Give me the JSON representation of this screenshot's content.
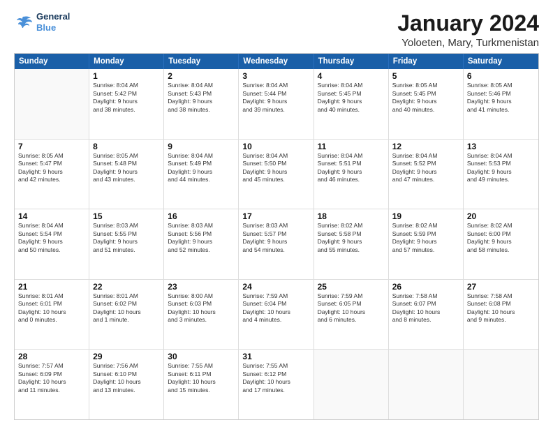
{
  "logo": {
    "line1": "General",
    "line2": "Blue"
  },
  "title": "January 2024",
  "subtitle": "Yoloeten, Mary, Turkmenistan",
  "weekdays": [
    "Sunday",
    "Monday",
    "Tuesday",
    "Wednesday",
    "Thursday",
    "Friday",
    "Saturday"
  ],
  "weeks": [
    [
      {
        "day": "",
        "info": ""
      },
      {
        "day": "1",
        "info": "Sunrise: 8:04 AM\nSunset: 5:42 PM\nDaylight: 9 hours\nand 38 minutes."
      },
      {
        "day": "2",
        "info": "Sunrise: 8:04 AM\nSunset: 5:43 PM\nDaylight: 9 hours\nand 38 minutes."
      },
      {
        "day": "3",
        "info": "Sunrise: 8:04 AM\nSunset: 5:44 PM\nDaylight: 9 hours\nand 39 minutes."
      },
      {
        "day": "4",
        "info": "Sunrise: 8:04 AM\nSunset: 5:45 PM\nDaylight: 9 hours\nand 40 minutes."
      },
      {
        "day": "5",
        "info": "Sunrise: 8:05 AM\nSunset: 5:45 PM\nDaylight: 9 hours\nand 40 minutes."
      },
      {
        "day": "6",
        "info": "Sunrise: 8:05 AM\nSunset: 5:46 PM\nDaylight: 9 hours\nand 41 minutes."
      }
    ],
    [
      {
        "day": "7",
        "info": "Sunrise: 8:05 AM\nSunset: 5:47 PM\nDaylight: 9 hours\nand 42 minutes."
      },
      {
        "day": "8",
        "info": "Sunrise: 8:05 AM\nSunset: 5:48 PM\nDaylight: 9 hours\nand 43 minutes."
      },
      {
        "day": "9",
        "info": "Sunrise: 8:04 AM\nSunset: 5:49 PM\nDaylight: 9 hours\nand 44 minutes."
      },
      {
        "day": "10",
        "info": "Sunrise: 8:04 AM\nSunset: 5:50 PM\nDaylight: 9 hours\nand 45 minutes."
      },
      {
        "day": "11",
        "info": "Sunrise: 8:04 AM\nSunset: 5:51 PM\nDaylight: 9 hours\nand 46 minutes."
      },
      {
        "day": "12",
        "info": "Sunrise: 8:04 AM\nSunset: 5:52 PM\nDaylight: 9 hours\nand 47 minutes."
      },
      {
        "day": "13",
        "info": "Sunrise: 8:04 AM\nSunset: 5:53 PM\nDaylight: 9 hours\nand 49 minutes."
      }
    ],
    [
      {
        "day": "14",
        "info": "Sunrise: 8:04 AM\nSunset: 5:54 PM\nDaylight: 9 hours\nand 50 minutes."
      },
      {
        "day": "15",
        "info": "Sunrise: 8:03 AM\nSunset: 5:55 PM\nDaylight: 9 hours\nand 51 minutes."
      },
      {
        "day": "16",
        "info": "Sunrise: 8:03 AM\nSunset: 5:56 PM\nDaylight: 9 hours\nand 52 minutes."
      },
      {
        "day": "17",
        "info": "Sunrise: 8:03 AM\nSunset: 5:57 PM\nDaylight: 9 hours\nand 54 minutes."
      },
      {
        "day": "18",
        "info": "Sunrise: 8:02 AM\nSunset: 5:58 PM\nDaylight: 9 hours\nand 55 minutes."
      },
      {
        "day": "19",
        "info": "Sunrise: 8:02 AM\nSunset: 5:59 PM\nDaylight: 9 hours\nand 57 minutes."
      },
      {
        "day": "20",
        "info": "Sunrise: 8:02 AM\nSunset: 6:00 PM\nDaylight: 9 hours\nand 58 minutes."
      }
    ],
    [
      {
        "day": "21",
        "info": "Sunrise: 8:01 AM\nSunset: 6:01 PM\nDaylight: 10 hours\nand 0 minutes."
      },
      {
        "day": "22",
        "info": "Sunrise: 8:01 AM\nSunset: 6:02 PM\nDaylight: 10 hours\nand 1 minute."
      },
      {
        "day": "23",
        "info": "Sunrise: 8:00 AM\nSunset: 6:03 PM\nDaylight: 10 hours\nand 3 minutes."
      },
      {
        "day": "24",
        "info": "Sunrise: 7:59 AM\nSunset: 6:04 PM\nDaylight: 10 hours\nand 4 minutes."
      },
      {
        "day": "25",
        "info": "Sunrise: 7:59 AM\nSunset: 6:05 PM\nDaylight: 10 hours\nand 6 minutes."
      },
      {
        "day": "26",
        "info": "Sunrise: 7:58 AM\nSunset: 6:07 PM\nDaylight: 10 hours\nand 8 minutes."
      },
      {
        "day": "27",
        "info": "Sunrise: 7:58 AM\nSunset: 6:08 PM\nDaylight: 10 hours\nand 9 minutes."
      }
    ],
    [
      {
        "day": "28",
        "info": "Sunrise: 7:57 AM\nSunset: 6:09 PM\nDaylight: 10 hours\nand 11 minutes."
      },
      {
        "day": "29",
        "info": "Sunrise: 7:56 AM\nSunset: 6:10 PM\nDaylight: 10 hours\nand 13 minutes."
      },
      {
        "day": "30",
        "info": "Sunrise: 7:55 AM\nSunset: 6:11 PM\nDaylight: 10 hours\nand 15 minutes."
      },
      {
        "day": "31",
        "info": "Sunrise: 7:55 AM\nSunset: 6:12 PM\nDaylight: 10 hours\nand 17 minutes."
      },
      {
        "day": "",
        "info": ""
      },
      {
        "day": "",
        "info": ""
      },
      {
        "day": "",
        "info": ""
      }
    ]
  ]
}
